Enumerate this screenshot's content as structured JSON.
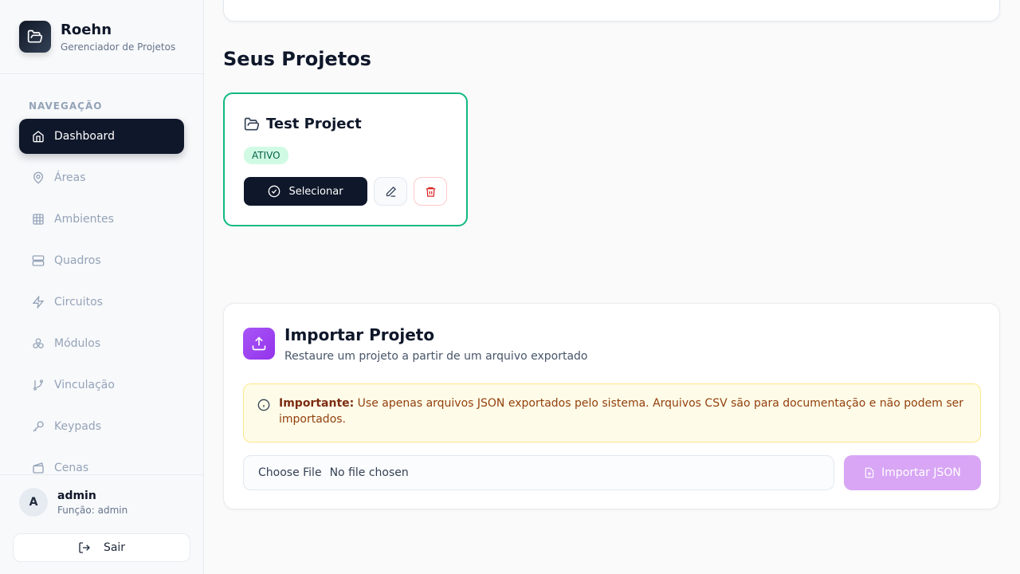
{
  "brand": {
    "name": "Roehn",
    "subtitle": "Gerenciador de Projetos"
  },
  "nav": {
    "section_label": "NAVEGAÇÃO",
    "items": [
      {
        "label": "Dashboard",
        "icon": "home-icon",
        "active": true
      },
      {
        "label": "Áreas",
        "icon": "map-pin-icon"
      },
      {
        "label": "Ambientes",
        "icon": "grid-icon"
      },
      {
        "label": "Quadros",
        "icon": "server-icon"
      },
      {
        "label": "Circuitos",
        "icon": "zap-icon"
      },
      {
        "label": "Módulos",
        "icon": "boxes-icon"
      },
      {
        "label": "Vinculação",
        "icon": "git-branch-icon"
      },
      {
        "label": "Keypads",
        "icon": "key-icon"
      },
      {
        "label": "Cenas",
        "icon": "clapperboard-icon"
      }
    ]
  },
  "user": {
    "initial": "A",
    "name": "admin",
    "role": "Função: admin",
    "logout_label": "Sair"
  },
  "projects": {
    "heading": "Seus Projetos",
    "items": [
      {
        "name": "Test Project",
        "status": "ATIVO",
        "select_label": "Selecionar"
      }
    ]
  },
  "import": {
    "title": "Importar Projeto",
    "subtitle": "Restaure um projeto a partir de um arquivo exportado",
    "alert_bold": "Importante:",
    "alert_text": " Use apenas arquivos JSON exportados pelo sistema. Arquivos CSV são para documentação e não podem ser importados.",
    "choose_file": "Choose File",
    "no_file": "No file chosen",
    "button_label": "Importar JSON"
  },
  "colors": {
    "accent": "#0f172a",
    "success": "#10b981",
    "purple": "#9333ea",
    "danger": "#dc2626"
  }
}
